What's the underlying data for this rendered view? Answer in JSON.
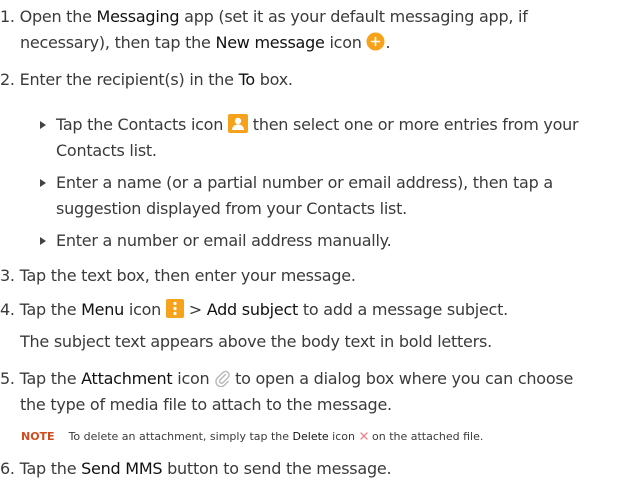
{
  "steps": {
    "s1": {
      "n": "1.",
      "a": "Open the ",
      "b": "Messaging",
      "c": " app (set it as your default messaging app, if",
      "d": "necessary), then tap the ",
      "e": "New message",
      "f": " icon ",
      "g": "."
    },
    "s2": {
      "n": "2.",
      "a": "Enter the recipient(s) in the ",
      "b": "To",
      "c": " box."
    },
    "s3": {
      "n": "3.",
      "a": "Tap the text box, then enter your message."
    },
    "s4": {
      "n": "4.",
      "a": "Tap the ",
      "b": "Menu",
      "c": " icon ",
      "d": " > ",
      "e": "Add subject",
      "f": " to add a message subject.",
      "sub": "The subject text appears above the body text in bold letters."
    },
    "s5": {
      "n": "5.",
      "a": "Tap the ",
      "b": "Attachment",
      "c": " icon ",
      "d": " to open a dialog box where you can choose",
      "e": "the type of media file to attach to the message."
    },
    "s6": {
      "n": "6.",
      "a": "Tap the ",
      "b": "Send MMS",
      "c": " button to send the message."
    }
  },
  "bullets": {
    "b1": {
      "a": "Tap the Contacts icon ",
      "b": " then select one or more entries from your",
      "c": "Contacts list."
    },
    "b2": {
      "a": "Enter a name (or a partial number or email address), then tap a",
      "b": "suggestion displayed from your Contacts list."
    },
    "b3": {
      "a": "Enter a number or email address manually."
    }
  },
  "note": {
    "label": "NOTE",
    "a": "To delete an attachment, simply tap the ",
    "b": "Delete",
    "c": " icon ",
    "d": " on the attached file."
  },
  "icons": {
    "new_message": "plus-circle-icon",
    "contacts": "person-icon",
    "menu": "vertical-dots-icon",
    "attachment": "paperclip-icon",
    "delete": "x-icon"
  },
  "colors": {
    "text": "#3a3a3a",
    "bold_text": "#111111",
    "icon_orange": "#f7a21b",
    "note_label": "#d14a1f",
    "delete_x": "#e8838a"
  }
}
